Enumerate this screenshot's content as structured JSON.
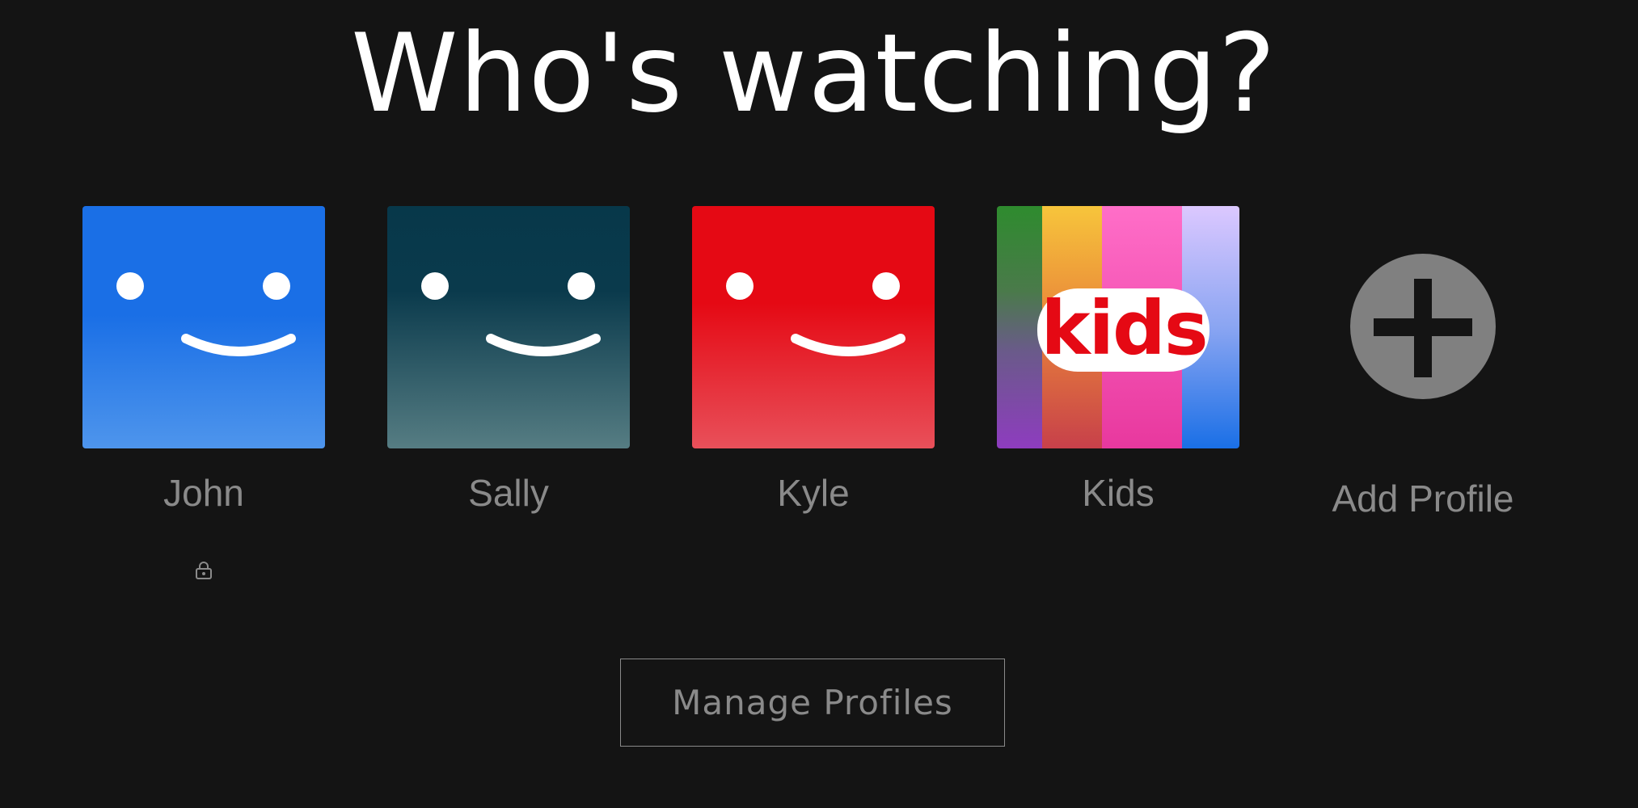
{
  "page": {
    "title": "Who's watching?"
  },
  "profiles": [
    {
      "name": "John",
      "avatar": "smiley-face",
      "color_top": "#1a6fe6",
      "color_bottom": "#4e95ec",
      "locked": true
    },
    {
      "name": "Sally",
      "avatar": "smiley-face",
      "color_top": "#07384a",
      "color_bottom": "#567d83",
      "locked": false
    },
    {
      "name": "Kyle",
      "avatar": "smiley-face",
      "color_top": "#e50914",
      "color_bottom": "#e8505a",
      "locked": false
    },
    {
      "name": "Kids",
      "avatar": "kids-logo",
      "avatar_text": "kids",
      "stripe_colors": [
        "#2e8b2e",
        "#f5a623",
        "#ff5cb8",
        "#b9a4ff"
      ],
      "locked": false
    }
  ],
  "add_profile": {
    "label": "Add Profile",
    "icon": "plus-icon",
    "circle_color": "#808080"
  },
  "manage_button": {
    "label": "Manage Profiles"
  },
  "colors": {
    "background": "#141414",
    "muted_text": "#8a8a8a",
    "title_text": "#ffffff"
  }
}
